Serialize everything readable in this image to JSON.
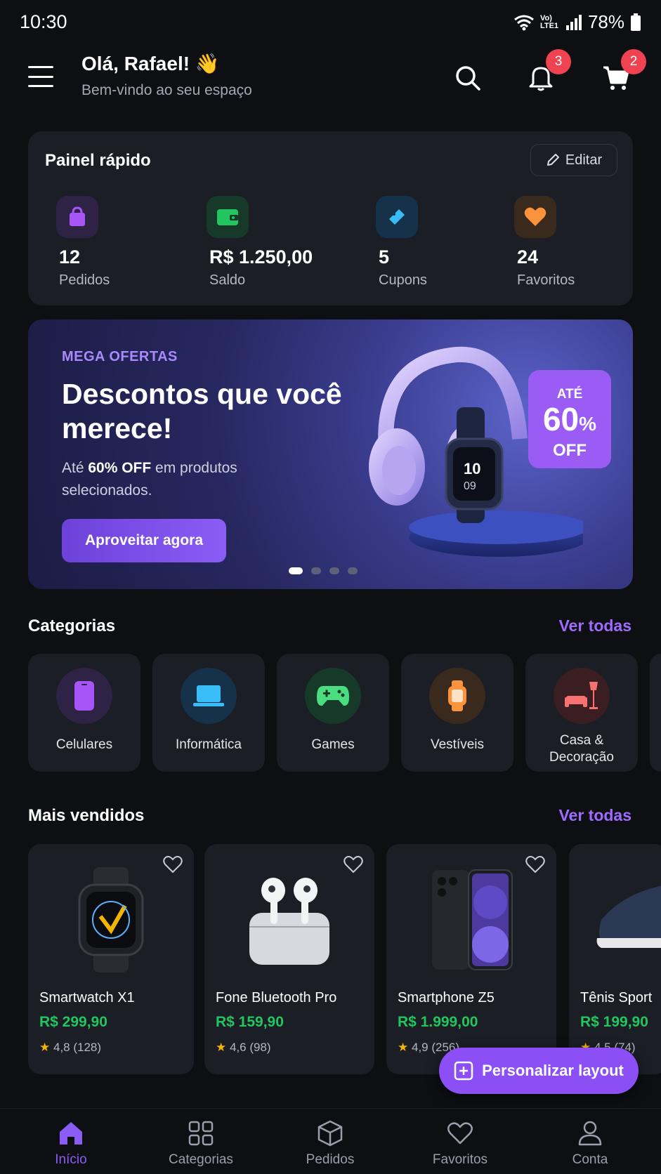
{
  "status_bar": {
    "time": "10:30",
    "battery": "78%",
    "network": "Vo) LTE1"
  },
  "header": {
    "greeting": "Olá, Rafael! 👋",
    "subtitle": "Bem-vindo ao seu espaço",
    "notifications_count": "3",
    "cart_count": "2"
  },
  "quick_panel": {
    "title": "Painel rápido",
    "edit_label": "Editar",
    "stats": [
      {
        "value": "12",
        "label": "Pedidos",
        "icon": "shopping-bag-icon",
        "color": "#a855f7"
      },
      {
        "value": "R$ 1.250,00",
        "label": "Saldo",
        "icon": "wallet-icon",
        "color": "#22c55e"
      },
      {
        "value": "5",
        "label": "Cupons",
        "icon": "ticket-icon",
        "color": "#38bdf8"
      },
      {
        "value": "24",
        "label": "Favoritos",
        "icon": "heart-icon",
        "color": "#fb923c"
      }
    ]
  },
  "banner": {
    "kicker": "MEGA OFERTAS",
    "headline": "Descontos que você merece!",
    "desc_prefix": "Até ",
    "desc_bold": "60% OFF",
    "desc_suffix": " em produtos selecionados.",
    "cta": "Aproveitar agora",
    "tag_top": "ATÉ",
    "tag_value": "60",
    "tag_unit": "%",
    "tag_bottom": "OFF",
    "watch_time_h": "10",
    "watch_time_m": "09",
    "active_slide": 1,
    "slide_count": 4
  },
  "categories": {
    "title": "Categorias",
    "link": "Ver todas",
    "items": [
      {
        "label": "Celulares",
        "icon": "smartphone-icon",
        "color": "#a855f7"
      },
      {
        "label": "Informática",
        "icon": "laptop-icon",
        "color": "#38bdf8"
      },
      {
        "label": "Games",
        "icon": "gamepad-icon",
        "color": "#4ade80"
      },
      {
        "label": "Vestíveis",
        "icon": "smartwatch-icon",
        "color": "#fb923c"
      },
      {
        "label": "Casa & Decoração",
        "icon": "sofa-lamp-icon",
        "color": "#f87171"
      }
    ]
  },
  "best_sellers": {
    "title": "Mais vendidos",
    "link": "Ver todas",
    "items": [
      {
        "name": "Smartwatch X1",
        "price": "R$ 299,90",
        "rating": "4,8",
        "reviews": "(128)"
      },
      {
        "name": "Fone Bluetooth Pro",
        "price": "R$ 159,90",
        "rating": "4,6",
        "reviews": "(98)"
      },
      {
        "name": "Smartphone Z5",
        "price": "R$ 1.999,00",
        "rating": "4,9",
        "reviews": "(256)"
      },
      {
        "name": "Tênis Sport",
        "price": "R$ 199,90",
        "rating": "4,5",
        "reviews": "(74)"
      }
    ]
  },
  "fab": {
    "label": "Personalizar layout"
  },
  "bottom_nav": {
    "items": [
      {
        "label": "Início",
        "icon": "home-icon",
        "active": true
      },
      {
        "label": "Categorias",
        "icon": "grid-icon",
        "active": false
      },
      {
        "label": "Pedidos",
        "icon": "box-icon",
        "active": false
      },
      {
        "label": "Favoritos",
        "icon": "heart-outline-icon",
        "active": false
      },
      {
        "label": "Conta",
        "icon": "user-icon",
        "active": false
      }
    ]
  },
  "colors": {
    "accent": "#8b5cf6",
    "price": "#22c55e",
    "badge": "#ef4352",
    "card": "#1b1e25",
    "background": "#0d0f13"
  }
}
